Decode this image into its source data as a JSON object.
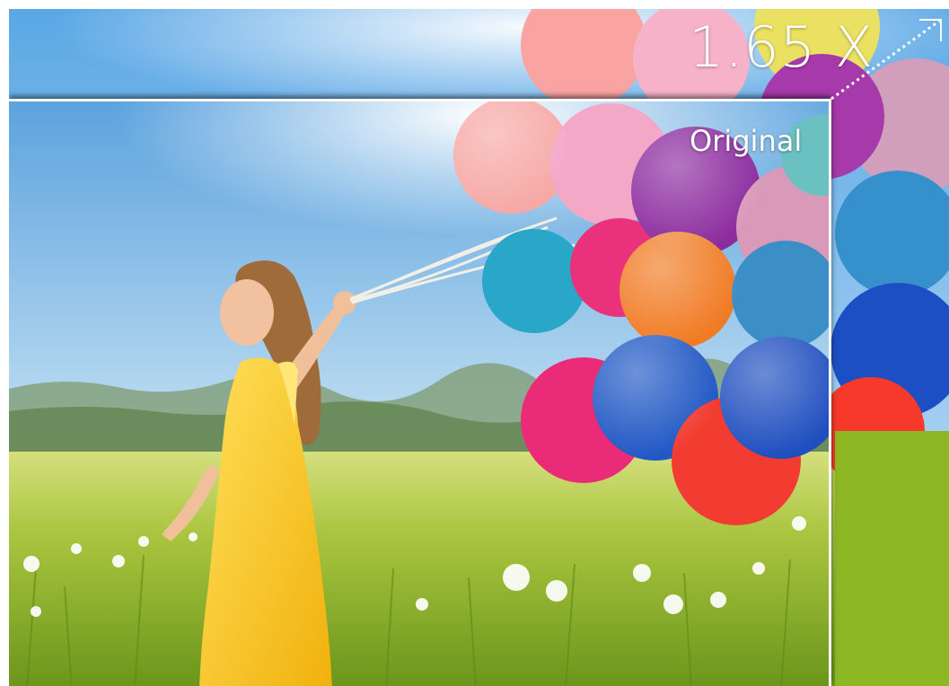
{
  "zoom_label": "1.65 X",
  "original_label": "Original",
  "colors": {
    "sky_top": "#6fb2e6",
    "sky_bottom": "#f3f7f9",
    "grass": "#8fb62a",
    "dress": "#f6c51b",
    "balloon_blue": "#1f57c4",
    "balloon_teal": "#2aa5c6",
    "balloon_pink": "#ea2a76",
    "balloon_red": "#f23a32",
    "balloon_orange": "#f07a22",
    "balloon_purple": "#8a2a9a"
  },
  "icons": {
    "expand_corner": "arrow-up-right-corner-icon"
  }
}
